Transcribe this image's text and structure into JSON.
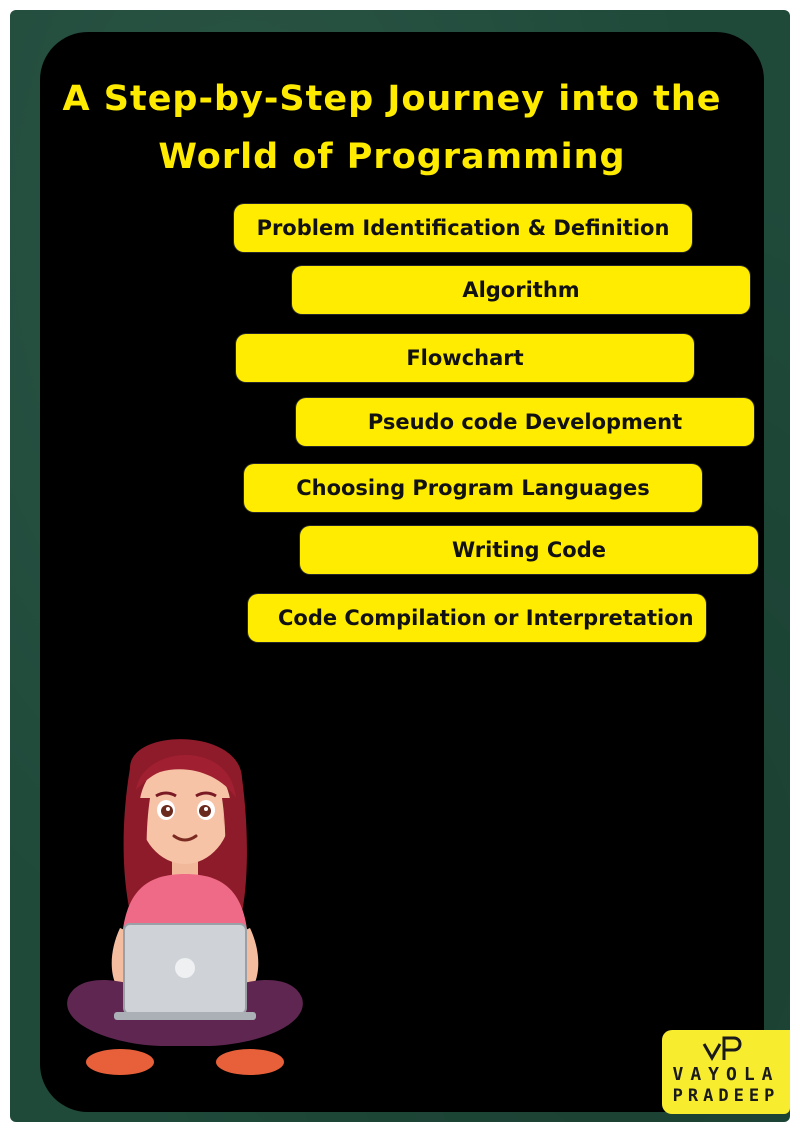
{
  "title": {
    "line1": "A Step-by-Step Journey into the",
    "line2": "World of Programming"
  },
  "steps": [
    {
      "label": "Problem Identification & Definition"
    },
    {
      "label": "Algorithm"
    },
    {
      "label": "Flowchart"
    },
    {
      "label": "Pseudo code Development"
    },
    {
      "label": "Choosing Program Languages"
    },
    {
      "label": "Writing Code"
    },
    {
      "label": "Code Compilation or Interpretation"
    }
  ],
  "logo": {
    "line1": "VAYOLA",
    "line2": "PRADEEP",
    "colors": {
      "background": "#f7ec2e",
      "text": "#1a1a1a"
    }
  },
  "colors": {
    "board": "#1f4a3a",
    "panel": "#000000",
    "accent": "#ffec00",
    "title": "#ffeb00"
  },
  "illustration": {
    "icon": "girl-with-laptop-icon"
  }
}
